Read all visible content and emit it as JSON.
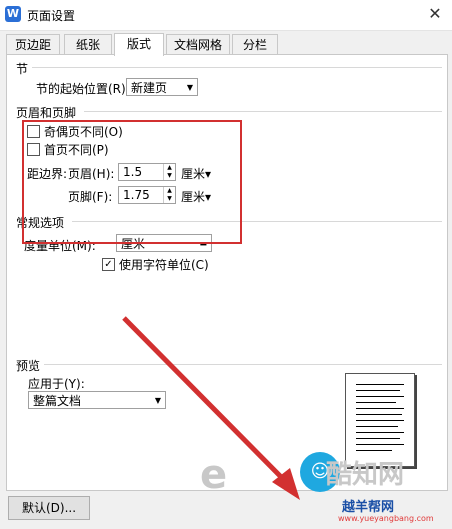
{
  "window": {
    "title": "页面设置",
    "close": "✕"
  },
  "tabs": [
    {
      "label": "页边距",
      "active": false
    },
    {
      "label": "纸张",
      "active": false
    },
    {
      "label": "版式",
      "active": true
    },
    {
      "label": "文档网格",
      "active": false
    },
    {
      "label": "分栏",
      "active": false
    }
  ],
  "section": {
    "title": "节",
    "start_label": "节的起始位置(R):",
    "start_value": "新建页"
  },
  "header_footer": {
    "title": "页眉和页脚",
    "odd_even_label": "奇偶页不同(O)",
    "odd_even_checked": false,
    "first_page_label": "首页不同(P)",
    "first_page_checked": false,
    "distance_label": "距边界:",
    "header_label": "页眉(H):",
    "header_value": "1.5",
    "header_unit": "厘米▾",
    "footer_label": "页脚(F):",
    "footer_value": "1.75",
    "footer_unit": "厘米▾"
  },
  "general": {
    "title": "常规选项",
    "measure_label": "度量单位(M):",
    "measure_value": "厘米",
    "char_unit_label": "使用字符单位(C)",
    "char_unit_checked": true
  },
  "preview": {
    "title": "预览",
    "apply_label": "应用于(Y):",
    "apply_value": "整篇文档"
  },
  "buttons": {
    "default": "默认(D)..."
  },
  "watermark": {
    "text": "酷知网",
    "brand": "越羊帮网",
    "url": "www.yueyangbang.com"
  },
  "colors": {
    "highlight": "#d23030",
    "accent": "#2b6fd6"
  }
}
